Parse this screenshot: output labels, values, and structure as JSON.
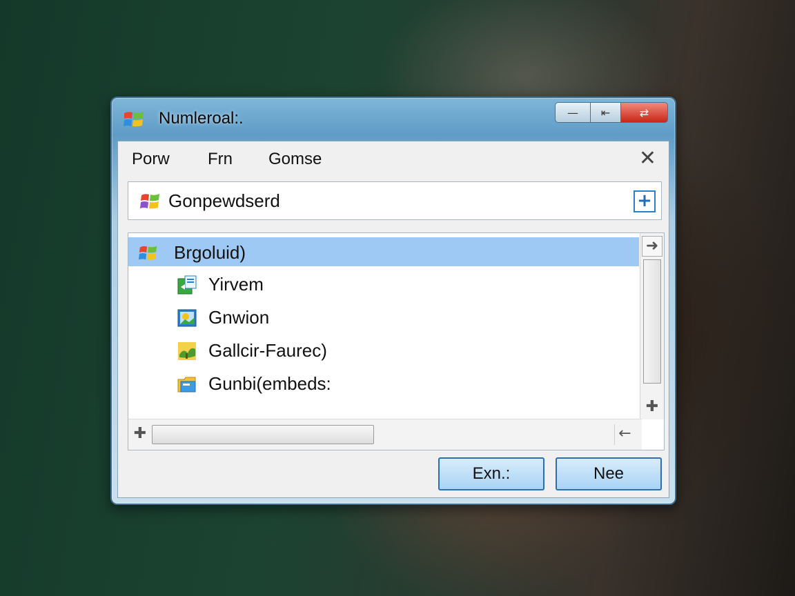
{
  "window": {
    "title": "Numleroal:.",
    "caption": {
      "minimize": "—",
      "restore": "⇤",
      "close": "⇄"
    }
  },
  "menu": {
    "items": [
      "Porw",
      "Frn",
      "Gomse"
    ],
    "close": "✕"
  },
  "path": {
    "value": "Gonpewdserd",
    "icon": "windows-flag-icon",
    "action": "+"
  },
  "list": {
    "items": [
      {
        "label": "Brgoluid)",
        "icon": "windows-flag-icon",
        "selected": true,
        "indent": 0
      },
      {
        "label": "Yirvem",
        "icon": "green-document-icon",
        "selected": false,
        "indent": 1
      },
      {
        "label": "Gnwion",
        "icon": "picture-icon",
        "selected": false,
        "indent": 1
      },
      {
        "label": "Gallcir-Faurec)",
        "icon": "tree-icon",
        "selected": false,
        "indent": 1
      },
      {
        "label": "Gunbi(embeds:",
        "icon": "folder-icon",
        "selected": false,
        "indent": 1
      }
    ],
    "scroll": {
      "up": "➜",
      "down": "✚",
      "left": "✚",
      "right": "←"
    }
  },
  "buttons": {
    "primary": "Exn.:",
    "secondary": "Nee"
  },
  "colors": {
    "selection": "#9ec9f5",
    "accent": "#2a6fb3",
    "close": "#c82716"
  }
}
